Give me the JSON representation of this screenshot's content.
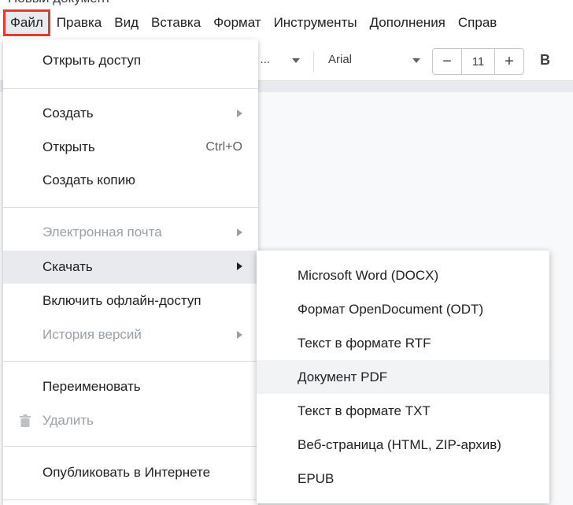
{
  "document": {
    "title": "Новый документ"
  },
  "menubar": {
    "items": [
      "Файл",
      "Правка",
      "Вид",
      "Вставка",
      "Формат",
      "Инструменты",
      "Дополнения",
      "Справ"
    ]
  },
  "toolbar": {
    "paragraph_style": "й ...",
    "font": "Arial",
    "font_size": "11",
    "decrease_label": "−",
    "increase_label": "+",
    "bold_label": "B"
  },
  "file_menu": {
    "share": "Открыть доступ",
    "create": "Создать",
    "open": "Открыть",
    "open_shortcut": "Ctrl+O",
    "make_copy": "Создать копию",
    "email": "Электронная почта",
    "download": "Скачать",
    "offline": "Включить офлайн-доступ",
    "version_history": "История версий",
    "rename": "Переименовать",
    "delete": "Удалить",
    "publish": "Опубликовать в Интернете"
  },
  "download_submenu": {
    "items": [
      "Microsoft Word (DOCX)",
      "Формат OpenDocument (ODT)",
      "Текст в формате RTF",
      "Документ PDF",
      "Текст в формате TXT",
      "Веб-страница (HTML, ZIP-архив)",
      "EPUB"
    ]
  },
  "colors": {
    "highlight_border": "#e53935",
    "hover_bg": "#e8eaed",
    "disabled_text": "#9aa0a6"
  }
}
